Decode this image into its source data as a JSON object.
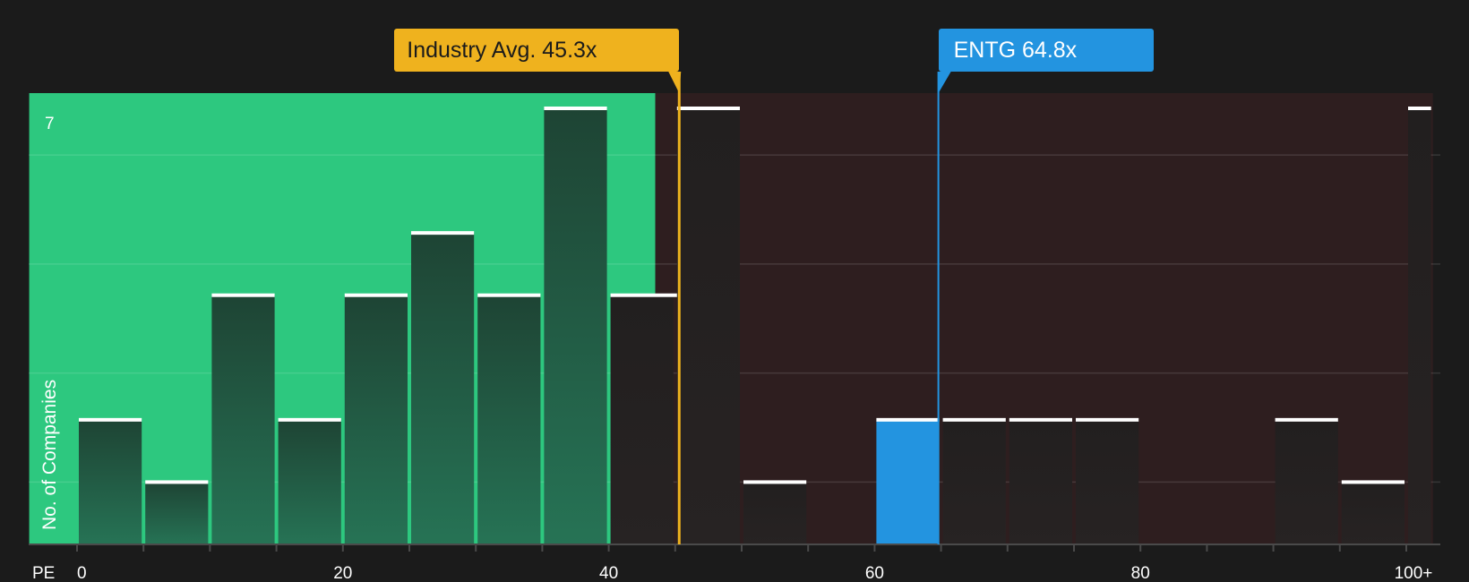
{
  "chart_data": {
    "type": "bar",
    "title": "",
    "xlabel": "PE",
    "ylabel": "No. of Companies",
    "x_ticks": [
      "0",
      "20",
      "40",
      "60",
      "80",
      "100+"
    ],
    "y_ticks": [
      "7"
    ],
    "bin_width": 5,
    "xlim": [
      0,
      102
    ],
    "ylim": [
      0,
      7.25
    ],
    "grid": true,
    "bins": [
      {
        "from": 0,
        "to": 5,
        "count": 2
      },
      {
        "from": 5,
        "to": 10,
        "count": 1
      },
      {
        "from": 10,
        "to": 15,
        "count": 4
      },
      {
        "from": 15,
        "to": 20,
        "count": 2
      },
      {
        "from": 20,
        "to": 25,
        "count": 4
      },
      {
        "from": 25,
        "to": 30,
        "count": 5
      },
      {
        "from": 30,
        "to": 35,
        "count": 4
      },
      {
        "from": 35,
        "to": 40,
        "count": 7
      },
      {
        "from": 40,
        "to": 45,
        "count": 4
      },
      {
        "from": 45,
        "to": 50,
        "count": 7
      },
      {
        "from": 50,
        "to": 55,
        "count": 1
      },
      {
        "from": 55,
        "to": 60,
        "count": 0
      },
      {
        "from": 60,
        "to": 65,
        "count": 2,
        "highlight": true
      },
      {
        "from": 65,
        "to": 70,
        "count": 2
      },
      {
        "from": 70,
        "to": 75,
        "count": 2
      },
      {
        "from": 75,
        "to": 80,
        "count": 2
      },
      {
        "from": 80,
        "to": 85,
        "count": 0
      },
      {
        "from": 85,
        "to": 90,
        "count": 0
      },
      {
        "from": 90,
        "to": 95,
        "count": 2
      },
      {
        "from": 95,
        "to": 100,
        "count": 1
      },
      {
        "from": 100,
        "to": 102,
        "count": 7
      }
    ],
    "markers": [
      {
        "kind": "industry",
        "label": "Industry Avg. 45.3x",
        "value": 45.3
      },
      {
        "kind": "company",
        "label": "ENTG 64.8x",
        "value": 64.8
      }
    ],
    "regions": [
      {
        "from": -3.6,
        "to": 43.5,
        "kind": "below-average"
      },
      {
        "from": 43.5,
        "to": 102,
        "kind": "above-average"
      }
    ],
    "colors": {
      "background": "#1b1b1b",
      "below_region": "#2dc87f",
      "above_region": "#2e1e1f",
      "bar_in_green": "#21473a",
      "bar_in_dark": "#242020",
      "bar_top": "#ffffff",
      "highlight_bar": "#2394e0",
      "industry_marker": "#efb21e",
      "company_marker": "#2394e0",
      "text": "#ffffff",
      "axis": "#4a4a4a"
    }
  }
}
